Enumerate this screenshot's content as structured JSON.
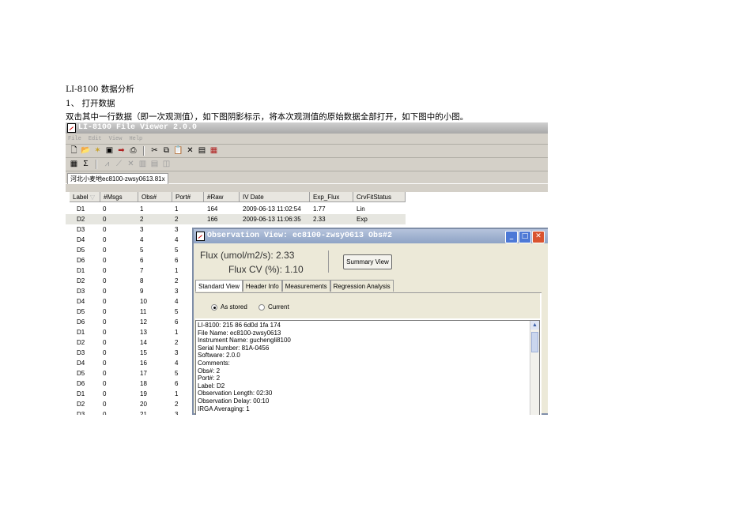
{
  "doc": {
    "title": "LI-8100 数据分析",
    "step": "1、 打开数据",
    "instruction": "双击其中一行数据（即一次观测值），如下图阴影标示，将本次观测值的原始数据全部打开，如下图中的小图。"
  },
  "app": {
    "title": "LI-8100 File Viewer 2.0.0",
    "menu": [
      "File",
      "Edit",
      "View",
      "Help"
    ],
    "file_tab": "河北小麦地ec8100-zwsy0613.81x",
    "columns": [
      "Label",
      "#Msgs",
      "Obs#",
      "Port#",
      "#Raw",
      "IV Date",
      "Exp_Flux",
      "CrvFitStatus"
    ],
    "rows": [
      {
        "label": "D1",
        "msgs": "0",
        "obs": "1",
        "port": "1",
        "raw": "164",
        "date": "2009-06-13 11:02:54",
        "flux": "1.77",
        "status": "Lin"
      },
      {
        "label": "D2",
        "msgs": "0",
        "obs": "2",
        "port": "2",
        "raw": "166",
        "date": "2009-06-13 11:06:35",
        "flux": "2.33",
        "status": "Exp"
      },
      {
        "label": "D3",
        "msgs": "0",
        "obs": "3",
        "port": "3",
        "raw": "",
        "date": "",
        "flux": "",
        "status": ""
      },
      {
        "label": "D4",
        "msgs": "0",
        "obs": "4",
        "port": "4",
        "raw": "",
        "date": "",
        "flux": "",
        "status": ""
      },
      {
        "label": "D5",
        "msgs": "0",
        "obs": "5",
        "port": "5",
        "raw": "",
        "date": "",
        "flux": "",
        "status": ""
      },
      {
        "label": "D6",
        "msgs": "0",
        "obs": "6",
        "port": "6",
        "raw": "",
        "date": "",
        "flux": "",
        "status": ""
      },
      {
        "label": "D1",
        "msgs": "0",
        "obs": "7",
        "port": "1",
        "raw": "",
        "date": "",
        "flux": "",
        "status": ""
      },
      {
        "label": "D2",
        "msgs": "0",
        "obs": "8",
        "port": "2",
        "raw": "",
        "date": "",
        "flux": "",
        "status": ""
      },
      {
        "label": "D3",
        "msgs": "0",
        "obs": "9",
        "port": "3",
        "raw": "",
        "date": "",
        "flux": "",
        "status": ""
      },
      {
        "label": "D4",
        "msgs": "0",
        "obs": "10",
        "port": "4",
        "raw": "",
        "date": "",
        "flux": "",
        "status": ""
      },
      {
        "label": "D5",
        "msgs": "0",
        "obs": "11",
        "port": "5",
        "raw": "",
        "date": "",
        "flux": "",
        "status": ""
      },
      {
        "label": "D6",
        "msgs": "0",
        "obs": "12",
        "port": "6",
        "raw": "",
        "date": "",
        "flux": "",
        "status": ""
      },
      {
        "label": "D1",
        "msgs": "0",
        "obs": "13",
        "port": "1",
        "raw": "",
        "date": "",
        "flux": "",
        "status": ""
      },
      {
        "label": "D2",
        "msgs": "0",
        "obs": "14",
        "port": "2",
        "raw": "",
        "date": "",
        "flux": "",
        "status": ""
      },
      {
        "label": "D3",
        "msgs": "0",
        "obs": "15",
        "port": "3",
        "raw": "",
        "date": "",
        "flux": "",
        "status": ""
      },
      {
        "label": "D4",
        "msgs": "0",
        "obs": "16",
        "port": "4",
        "raw": "",
        "date": "",
        "flux": "",
        "status": ""
      },
      {
        "label": "D5",
        "msgs": "0",
        "obs": "17",
        "port": "5",
        "raw": "",
        "date": "",
        "flux": "",
        "status": ""
      },
      {
        "label": "D6",
        "msgs": "0",
        "obs": "18",
        "port": "6",
        "raw": "",
        "date": "",
        "flux": "",
        "status": ""
      },
      {
        "label": "D1",
        "msgs": "0",
        "obs": "19",
        "port": "1",
        "raw": "",
        "date": "",
        "flux": "",
        "status": ""
      },
      {
        "label": "D2",
        "msgs": "0",
        "obs": "20",
        "port": "2",
        "raw": "",
        "date": "",
        "flux": "",
        "status": ""
      },
      {
        "label": "D3",
        "msgs": "0",
        "obs": "21",
        "port": "3",
        "raw": "",
        "date": "",
        "flux": "",
        "status": ""
      }
    ]
  },
  "dialog": {
    "title": "Observation View: ec8100-zwsy0613 Obs#2",
    "flux": "Flux (umol/m2/s):  2.33",
    "flux_cv": "Flux CV (%):  1.10",
    "summary_button": "Summary View",
    "tabs": [
      "Standard View",
      "Header Info",
      "Measurements",
      "Regression Analysis"
    ],
    "radio_as_stored": "As stored",
    "radio_current": "Current",
    "text_lines": [
      "LI-8100:      215          86        6d0d         1fa           174",
      "File Name:               ec8100-zwsy0613",
      "Instrument Name:   guchengli8100",
      "Serial Number:       81A-0456",
      "Software: 2.0.0",
      "Comments:",
      "Obs#:     2",
      "Port#:     2",
      "Label:     D2",
      "Observation Length:                02:30",
      "Observation Delay:  00:10",
      "IRGA Averaging:     1"
    ]
  }
}
